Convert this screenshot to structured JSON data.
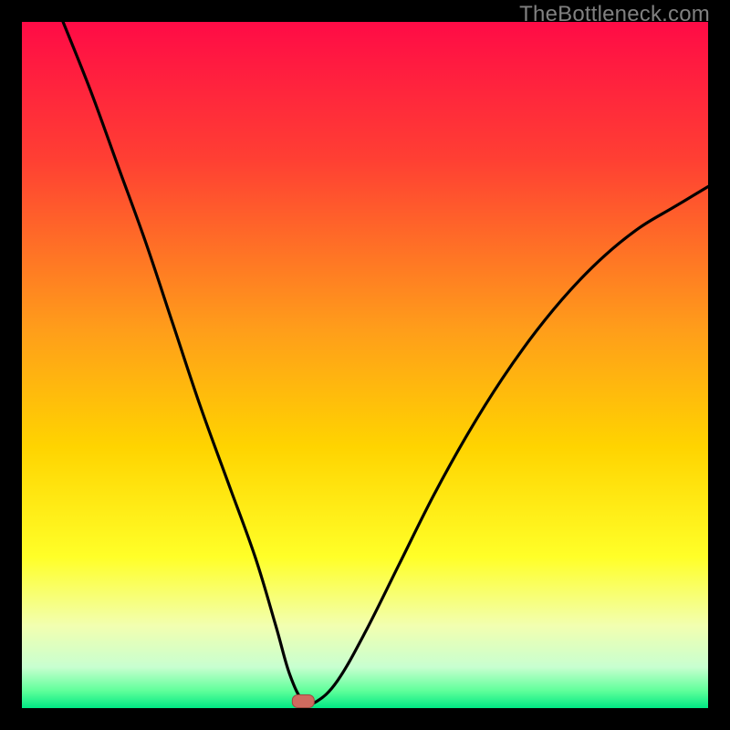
{
  "watermark": "TheBottleneck.com",
  "colors": {
    "frame": "#000000",
    "curve": "#000000",
    "marker_fill": "#cf6a5f",
    "marker_stroke": "#9e4a41",
    "gradient_stops": [
      {
        "offset": 0.0,
        "color": "#ff0b46"
      },
      {
        "offset": 0.2,
        "color": "#ff3f33"
      },
      {
        "offset": 0.45,
        "color": "#ff9e1a"
      },
      {
        "offset": 0.62,
        "color": "#ffd400"
      },
      {
        "offset": 0.78,
        "color": "#ffff28"
      },
      {
        "offset": 0.88,
        "color": "#f2ffb0"
      },
      {
        "offset": 0.94,
        "color": "#c8ffd0"
      },
      {
        "offset": 0.975,
        "color": "#5fff9a"
      },
      {
        "offset": 1.0,
        "color": "#00e884"
      }
    ]
  },
  "chart_data": {
    "type": "line",
    "title": "",
    "xlabel": "",
    "ylabel": "",
    "xlim": [
      0,
      100
    ],
    "ylim": [
      0,
      100
    ],
    "grid": false,
    "legend": false,
    "marker": {
      "x": 41,
      "y": 1
    },
    "series": [
      {
        "name": "curve",
        "x": [
          6,
          10,
          14,
          18,
          22,
          26,
          30,
          34,
          37,
          39,
          41,
          43,
          46,
          50,
          55,
          60,
          65,
          70,
          75,
          80,
          85,
          90,
          95,
          100
        ],
        "y": [
          100,
          90,
          79,
          68,
          56,
          44,
          33,
          22,
          12,
          5,
          1,
          1,
          4,
          11,
          21,
          31,
          40,
          48,
          55,
          61,
          66,
          70,
          73,
          76
        ]
      }
    ],
    "notes": "Background is a vertical red→yellow→green gradient; a single black V-shaped curve dips to ~1 at x≈41 where a small rounded marker sits. Values estimated from pixels."
  }
}
